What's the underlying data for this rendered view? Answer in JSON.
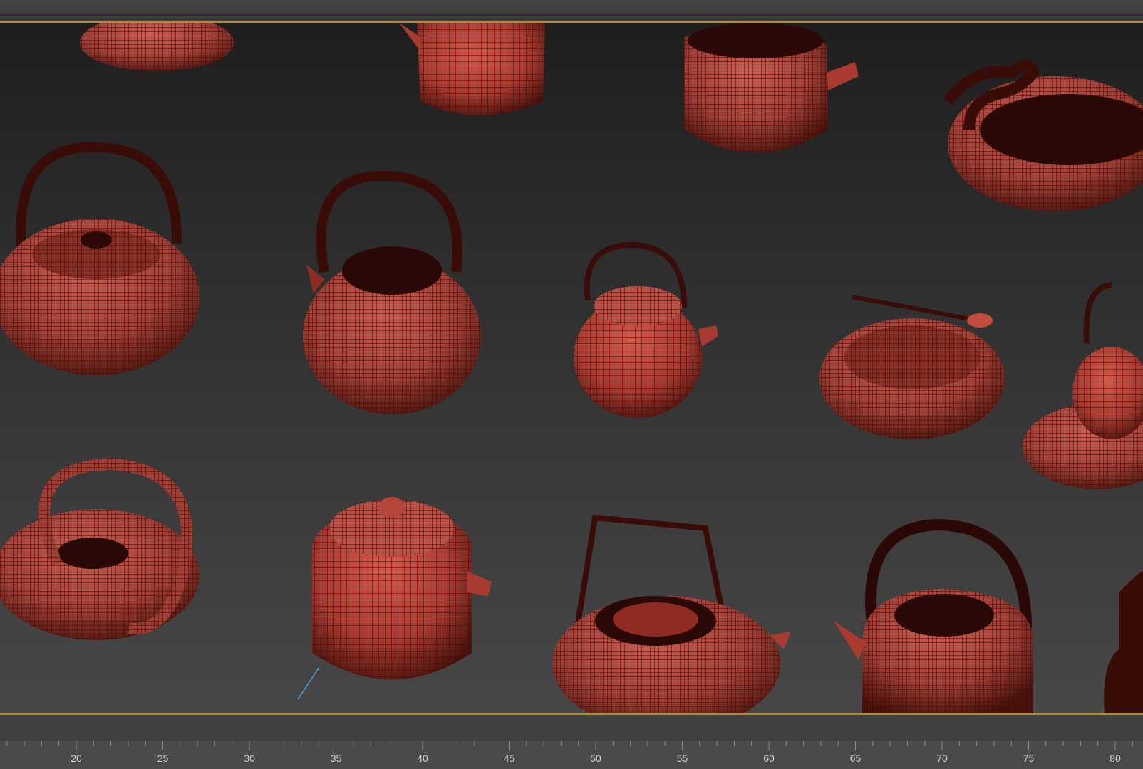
{
  "viewport": {
    "object_color": "#b8453a",
    "wire_color": "#3a0c08",
    "background_top": "#1e1e1e",
    "background_bottom": "#474747",
    "objects": [
      {
        "name": "teapot-partial-top-left"
      },
      {
        "name": "teapot-cylinder-top"
      },
      {
        "name": "teapot-lantern-top"
      },
      {
        "name": "teapot-gourd-right"
      },
      {
        "name": "kettle-flat-handle-left"
      },
      {
        "name": "kettle-octagonal"
      },
      {
        "name": "kettle-small-round"
      },
      {
        "name": "teapot-disc-spoon"
      },
      {
        "name": "kettle-on-tray-right"
      },
      {
        "name": "teapot-loop-handle-bottom-left"
      },
      {
        "name": "teapot-cylinder-bottom"
      },
      {
        "name": "kettle-bail-handle-bottom"
      },
      {
        "name": "kettle-arched-bottom-right"
      },
      {
        "name": "kettle-partial-bottom-edge"
      }
    ]
  },
  "timeline": {
    "accent_color": "#b48a2c",
    "ruler_labels": [
      "20",
      "25",
      "30",
      "35",
      "40",
      "45",
      "50",
      "55",
      "60",
      "65",
      "70",
      "75",
      "80"
    ]
  }
}
